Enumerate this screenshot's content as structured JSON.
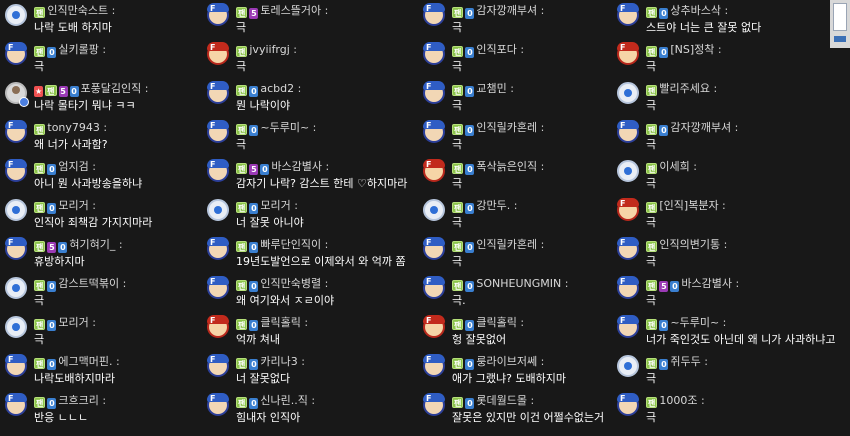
{
  "chat": {
    "columns": [
      {
        "messages": [
          {
            "avatar": "c",
            "badges": [
              "팬"
            ],
            "name": "인직만숙스트",
            "text": "나락 도배 하지마"
          },
          {
            "avatar": "j",
            "badges": [
              "팬",
              "0"
            ],
            "name": "실키롤팡",
            "text": "극"
          },
          {
            "avatar": "p",
            "badges": [
              "★",
              "팬",
              "5",
              "0"
            ],
            "name": "포풍달김인직",
            "text": "나락 몰타기 뭐냐 ㅋㅋ"
          },
          {
            "avatar": "j",
            "badges": [
              "팬"
            ],
            "name": "tony7943",
            "text": "왜 너가 사과함?"
          },
          {
            "avatar": "j",
            "badges": [
              "팬",
              "0"
            ],
            "name": "엄지검",
            "text": "아니 뭔 사과방송을하냐"
          },
          {
            "avatar": "c",
            "badges": [
              "팬",
              "0"
            ],
            "name": "모리거",
            "text": "인직아 죄책감 가지지마라"
          },
          {
            "avatar": "j",
            "badges": [
              "팬",
              "5",
              "0"
            ],
            "name": "혀기혀기_",
            "text": "휴방하지마"
          },
          {
            "avatar": "c",
            "badges": [
              "팬",
              "0"
            ],
            "name": "감스트떡볶이",
            "text": "극"
          },
          {
            "avatar": "c",
            "badges": [
              "팬",
              "0"
            ],
            "name": "모리거",
            "text": "극"
          },
          {
            "avatar": "j",
            "badges": [
              "팬",
              "0"
            ],
            "name": "에그맥머핀.",
            "text": "나락도배하지마라"
          },
          {
            "avatar": "j",
            "badges": [
              "팬",
              "0"
            ],
            "name": "크흐크리",
            "text": "반응 ㄴㄴㄴ"
          }
        ]
      },
      {
        "messages": [
          {
            "avatar": "j",
            "badges": [
              "팬",
              "5"
            ],
            "name": "토레스뜰거아",
            "text": "극"
          },
          {
            "avatar": "r",
            "badges": [
              "팬"
            ],
            "name": "jvyiifrgj",
            "text": "극"
          },
          {
            "avatar": "j",
            "badges": [
              "팬",
              "0"
            ],
            "name": "acbd2",
            "text": "뭔 나락이야"
          },
          {
            "avatar": "j",
            "badges": [
              "팬",
              "0"
            ],
            "name": "~두루미~",
            "text": "극"
          },
          {
            "avatar": "j",
            "badges": [
              "팬",
              "5",
              "0"
            ],
            "name": "바스감별사",
            "text": "감자기 나락? 감스트 한테 ♡하지마라"
          },
          {
            "avatar": "c",
            "badges": [
              "팬",
              "0"
            ],
            "name": "모리거",
            "text": "너 잘못 아니야"
          },
          {
            "avatar": "j",
            "badges": [
              "팬",
              "0"
            ],
            "name": "빠루단인직이",
            "text": "19년도발언으로 이제와서 와 억까 쫌"
          },
          {
            "avatar": "j",
            "badges": [
              "팬",
              "0"
            ],
            "name": "인직만숙병렬",
            "text": "왜 여기와서 ㅈㄹ이야"
          },
          {
            "avatar": "r",
            "badges": [
              "팬",
              "0"
            ],
            "name": "클릭홀릭",
            "text": "억까 쳐내"
          },
          {
            "avatar": "j",
            "badges": [
              "팬",
              "0"
            ],
            "name": "카리나3",
            "text": "너 잘못없다"
          },
          {
            "avatar": "j",
            "badges": [
              "팬",
              "0"
            ],
            "name": "신나린..직",
            "text": "힘내자 인직아"
          }
        ]
      },
      {
        "messages": [
          {
            "avatar": "j",
            "badges": [
              "팬",
              "0"
            ],
            "name": "감자깡깨부셔",
            "text": "극"
          },
          {
            "avatar": "j",
            "badges": [
              "팬",
              "0"
            ],
            "name": "인직포다",
            "text": "극"
          },
          {
            "avatar": "j",
            "badges": [
              "팬",
              "0"
            ],
            "name": "교챔민",
            "text": "극"
          },
          {
            "avatar": "j",
            "badges": [
              "팬",
              "0"
            ],
            "name": "인직릴카혼레",
            "text": "극"
          },
          {
            "avatar": "r",
            "badges": [
              "팬",
              "0"
            ],
            "name": "폭삭늙은인직",
            "text": "극"
          },
          {
            "avatar": "c",
            "badges": [
              "팬",
              "0"
            ],
            "name": "강만두.",
            "text": "극"
          },
          {
            "avatar": "j",
            "badges": [
              "팬",
              "0"
            ],
            "name": "인직릴카혼레",
            "text": "극"
          },
          {
            "avatar": "j",
            "badges": [
              "팬",
              "0"
            ],
            "name": "SONHEUNGMIN",
            "text": "극."
          },
          {
            "avatar": "r",
            "badges": [
              "팬",
              "0"
            ],
            "name": "클릭홀릭",
            "text": "헝 잘못없어"
          },
          {
            "avatar": "j",
            "badges": [
              "팬",
              "0"
            ],
            "name": "룽라이브저쎄",
            "text": "애가 그랬냐? 도배하지마"
          },
          {
            "avatar": "j",
            "badges": [
              "팬",
              "0"
            ],
            "name": "롯데월드몰",
            "text": "잘못은 있지만 이건 어쩔수없는거"
          }
        ]
      },
      {
        "messages": [
          {
            "avatar": "j",
            "badges": [
              "팬",
              "0"
            ],
            "name": "상추바스삭",
            "text": "스트야 너는 큰 잘못 없다"
          },
          {
            "avatar": "r",
            "badges": [
              "팬",
              "0"
            ],
            "name": "[NS]정착",
            "text": "극"
          },
          {
            "avatar": "c",
            "badges": [
              "팬"
            ],
            "name": "빨리주세요",
            "text": "극"
          },
          {
            "avatar": "j",
            "badges": [
              "팬",
              "0"
            ],
            "name": "감자깡깨부셔",
            "text": "극"
          },
          {
            "avatar": "c",
            "badges": [
              "팬"
            ],
            "name": "이세희",
            "text": "극"
          },
          {
            "avatar": "r",
            "badges": [
              "팬"
            ],
            "name": "[인직]복분자",
            "text": "극"
          },
          {
            "avatar": "j",
            "badges": [
              "팬"
            ],
            "name": "인직의변기통",
            "text": "극"
          },
          {
            "avatar": "j",
            "badges": [
              "팬",
              "5",
              "0"
            ],
            "name": "바스감별사",
            "text": "극"
          },
          {
            "avatar": "j",
            "badges": [
              "팬",
              "0"
            ],
            "name": "~두루미~",
            "text": "너가 죽인것도 아닌데 왜 니가 사과하냐고"
          },
          {
            "avatar": "c",
            "badges": [
              "팬",
              "0"
            ],
            "name": "쥐두두",
            "text": "극"
          },
          {
            "avatar": "j",
            "badges": [
              "팬"
            ],
            "name": "1000조",
            "text": "극"
          }
        ]
      }
    ]
  }
}
